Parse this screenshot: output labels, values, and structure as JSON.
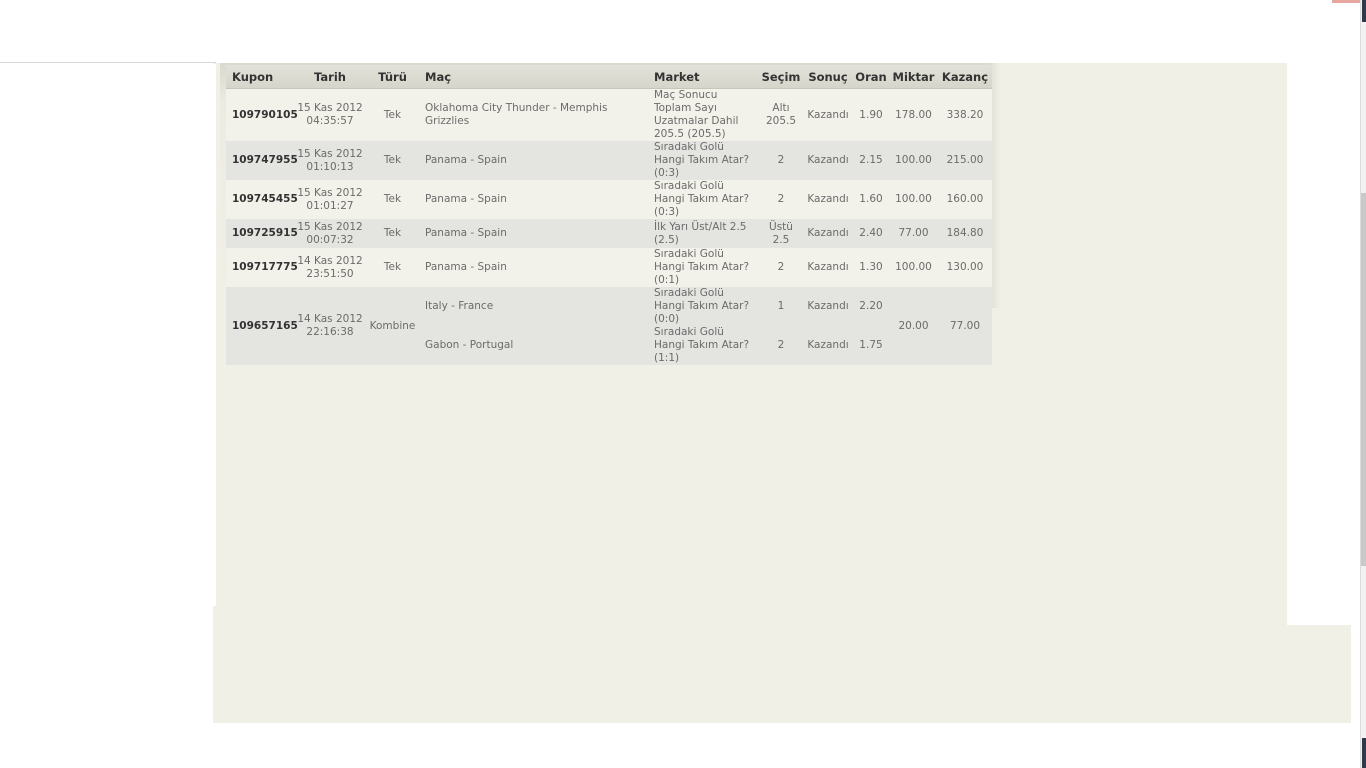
{
  "table": {
    "headers": {
      "kupon": "Kupon",
      "tarih": "Tarih",
      "turu": "Türü",
      "mac": "Maç",
      "market": "Market",
      "secim": "Seçim",
      "sonuc": "Sonuç",
      "oran": "Oran",
      "miktar": "Miktar",
      "kazanc": "Kazanç"
    },
    "rows": [
      {
        "kupon": "109790105",
        "date": "15 Kas 2012",
        "time": "04:35:57",
        "turu": "Tek",
        "mac": "Oklahoma City Thunder - Memphis Grizzlies",
        "market": "Maç Sonucu Toplam Sayı Uzatmalar Dahil 205.5 (205.5)",
        "secim": "Altı 205.5",
        "sonuc": "Kazandı",
        "oran": "1.90",
        "miktar": "178.00",
        "kazanc": "338.20"
      },
      {
        "kupon": "109747955",
        "date": "15 Kas 2012",
        "time": "01:10:13",
        "turu": "Tek",
        "mac": "Panama - Spain",
        "market": "Sıradaki Golü Hangi Takım Atar? (0:3)",
        "secim": "2",
        "sonuc": "Kazandı",
        "oran": "2.15",
        "miktar": "100.00",
        "kazanc": "215.00"
      },
      {
        "kupon": "109745455",
        "date": "15 Kas 2012",
        "time": "01:01:27",
        "turu": "Tek",
        "mac": "Panama - Spain",
        "market": "Sıradaki Golü Hangi Takım Atar? (0:3)",
        "secim": "2",
        "sonuc": "Kazandı",
        "oran": "1.60",
        "miktar": "100.00",
        "kazanc": "160.00"
      },
      {
        "kupon": "109725915",
        "date": "15 Kas 2012",
        "time": "00:07:32",
        "turu": "Tek",
        "mac": "Panama - Spain",
        "market": "İlk Yarı Üst/Alt 2.5 (2.5)",
        "secim": "Üstü 2.5",
        "sonuc": "Kazandı",
        "oran": "2.40",
        "miktar": "77.00",
        "kazanc": "184.80"
      },
      {
        "kupon": "109717775",
        "date": "14 Kas 2012",
        "time": "23:51:50",
        "turu": "Tek",
        "mac": "Panama - Spain",
        "market": "Sıradaki Golü Hangi Takım Atar? (0:1)",
        "secim": "2",
        "sonuc": "Kazandı",
        "oran": "1.30",
        "miktar": "100.00",
        "kazanc": "130.00"
      }
    ],
    "combo": {
      "kupon": "109657165",
      "date": "14 Kas 2012",
      "time": "22:16:38",
      "turu": "Kombine",
      "miktar": "20.00",
      "kazanc": "77.00",
      "legs": [
        {
          "mac": "Italy - France",
          "market": "Sıradaki Golü Hangi Takım Atar? (0:0)",
          "secim": "1",
          "sonuc": "Kazandı",
          "oran": "2.20"
        },
        {
          "mac": "Gabon - Portugal",
          "market": "Sıradaki Golü Hangi Takım Atar? (1:1)",
          "secim": "2",
          "sonuc": "Kazandı",
          "oran": "1.75"
        }
      ]
    }
  }
}
